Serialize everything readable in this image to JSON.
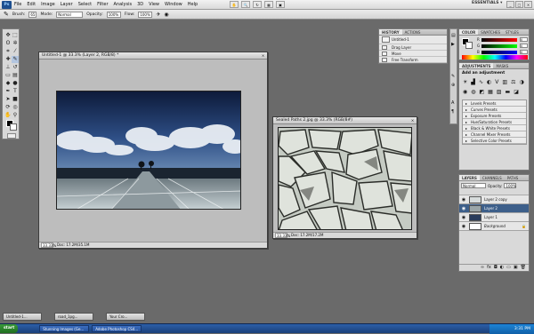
{
  "menubar": {
    "logo": "Ps",
    "items": [
      "File",
      "Edit",
      "Image",
      "Layer",
      "Select",
      "Filter",
      "Analysis",
      "3D",
      "View",
      "Window",
      "Help"
    ],
    "workspace": "ESSENTIALS ▾",
    "window_buttons": [
      "_",
      "□",
      "×"
    ]
  },
  "options": {
    "brush_label": "Brush:",
    "brush_size": "65",
    "mode_label": "Mode:",
    "mode_value": "Normal",
    "opacity_label": "Opacity:",
    "opacity_value": "100%",
    "flow_label": "Flow:",
    "flow_value": "100%"
  },
  "doc1": {
    "title": "Untitled-1 @ 33.3% (Layer 2, RGB/8) *",
    "zoom": "33.33%",
    "doc_info": "Doc: 17.2M/35.1M"
  },
  "doc2": {
    "title": "Sealed Paths 2.jpg @ 33.3% (RGB/8#)",
    "zoom": "33.33%",
    "doc_info": "Doc: 17.2M/17.2M"
  },
  "history": {
    "tabs": [
      "HISTORY",
      "ACTIONS"
    ],
    "snapshot": "Untitled-1",
    "rows": [
      "Drag Layer",
      "Move",
      "Free Transform"
    ]
  },
  "color": {
    "tabs": [
      "COLOR",
      "SWATCHES",
      "STYLES"
    ],
    "channels": [
      "R",
      "G",
      "B"
    ],
    "values": [
      "0",
      "0",
      "0"
    ]
  },
  "adjustments": {
    "tabs": [
      "ADJUSTMENTS",
      "MASKS"
    ],
    "title": "Add an adjustment",
    "presets": [
      "Levels Presets",
      "Curves Presets",
      "Exposure Presets",
      "Hue/Saturation Presets",
      "Black & White Presets",
      "Channel Mixer Presets",
      "Selective Color Presets"
    ]
  },
  "layers": {
    "tabs": [
      "LAYERS",
      "CHANNELS",
      "PATHS"
    ],
    "blend_mode": "Normal",
    "opacity_label": "Opacity:",
    "opacity_value": "100%",
    "rows": [
      "Layer 2 copy",
      "Layer 2",
      "Layer 1",
      "Background"
    ]
  },
  "minidocs": [
    "Untitled-1...",
    "road_1pg...",
    "Your Cro..."
  ],
  "taskbar": {
    "start": "start",
    "items": [
      "Stunning Images (Ge...",
      "Adobe Photoshop CS4..."
    ],
    "clock": "3:31 PM"
  },
  "colors": {
    "selected_layer": "#3d5f8a",
    "sky_top": "#0d1a3a",
    "taskbar": "#2c5fa8"
  }
}
